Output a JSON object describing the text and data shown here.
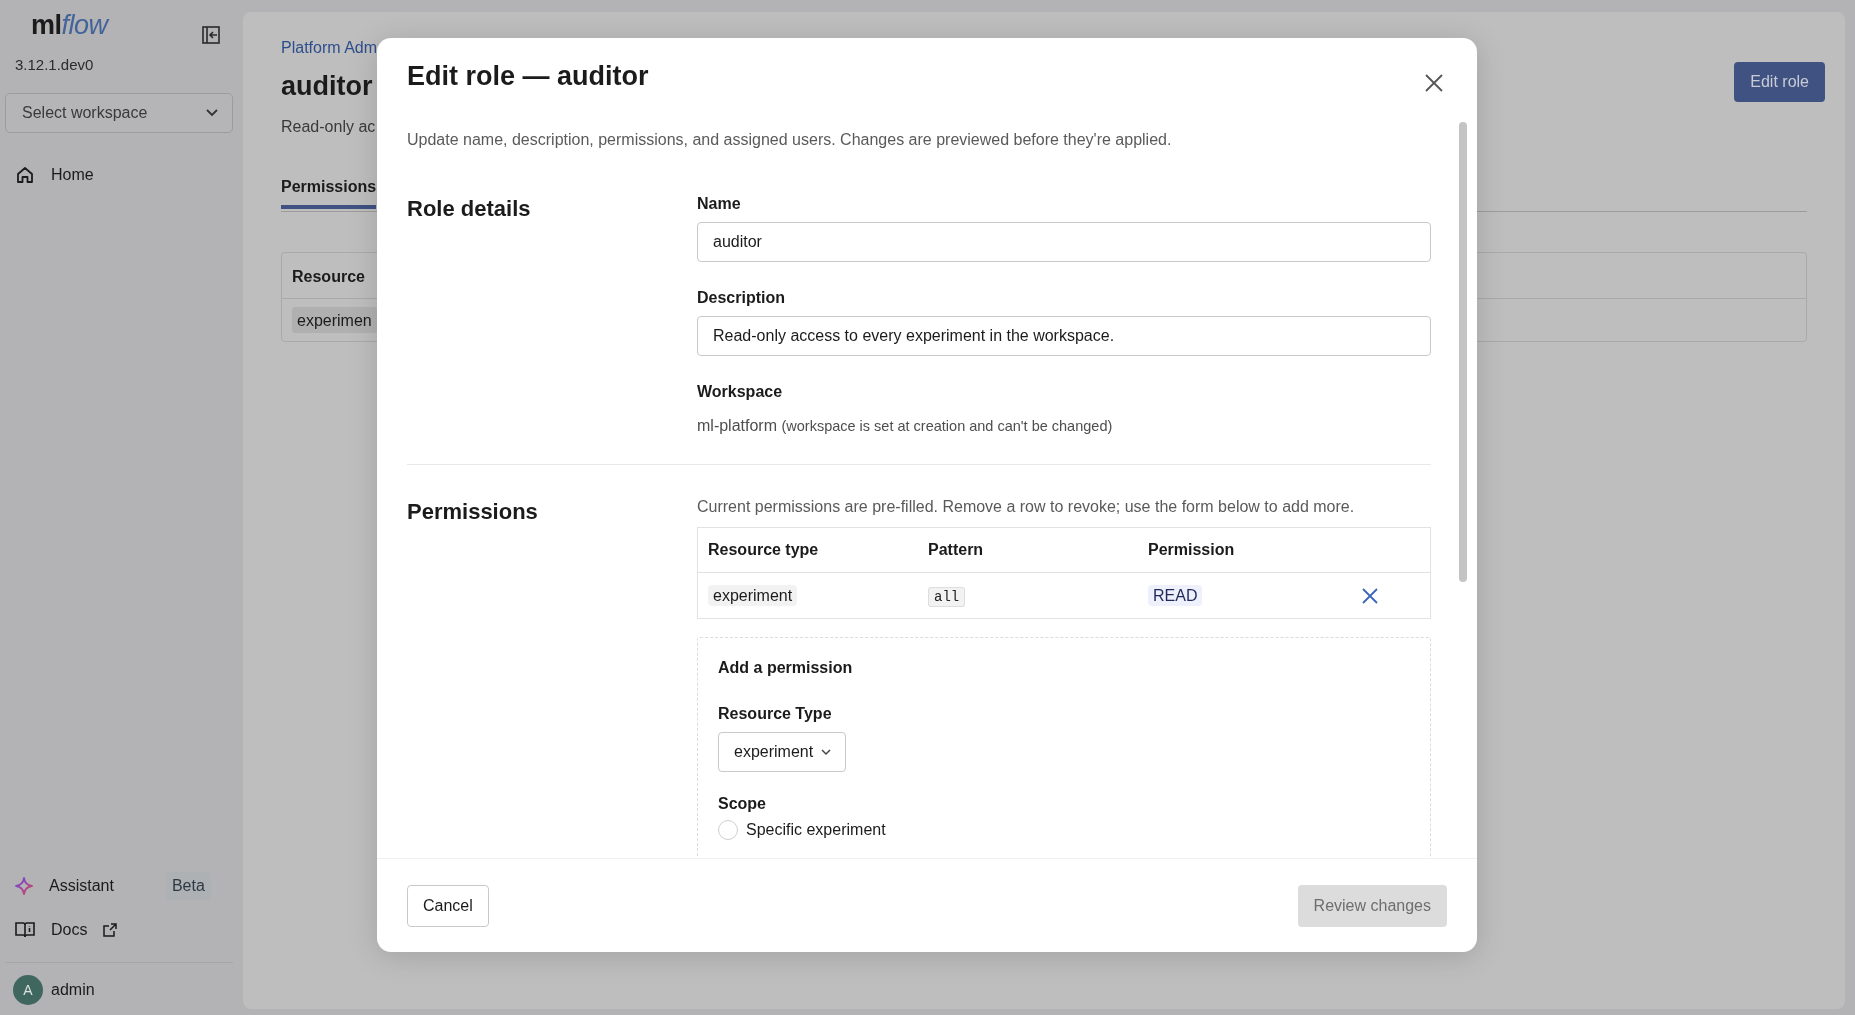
{
  "sidebar": {
    "logo": {
      "plain": "ml",
      "styled": "flow"
    },
    "version": "3.12.1.dev0",
    "workspace_select": {
      "placeholder": "Select workspace"
    },
    "nav_items": [
      {
        "label": "Home"
      }
    ],
    "bottom_items": [
      {
        "label": "Assistant",
        "badge": "Beta",
        "external": false
      },
      {
        "label": "Docs",
        "external": true
      }
    ],
    "user": {
      "initial": "A",
      "name": "admin"
    }
  },
  "page": {
    "breadcrumb": "Platform Adm",
    "title": "auditor",
    "subtitle": "Read-only ac",
    "edit_button": "Edit role",
    "tabs": [
      {
        "label": "Permissions",
        "selected": true
      }
    ],
    "table": {
      "columns": [
        "Resource"
      ],
      "rows": [
        [
          "experimen"
        ]
      ]
    }
  },
  "modal": {
    "title": "Edit role — auditor",
    "description": "Update name, description, permissions, and assigned users. Changes are previewed before they're applied.",
    "role_details": {
      "heading": "Role details",
      "fields": [
        {
          "label": "Name",
          "value": "auditor"
        },
        {
          "label": "Description",
          "value": "Read-only access to every experiment in the workspace."
        }
      ],
      "workspace": {
        "label": "Workspace",
        "value": "ml-platform",
        "note": "(workspace is set at creation and can't be changed)"
      }
    },
    "permissions": {
      "heading": "Permissions",
      "hint": "Current permissions are pre-filled. Remove a row to revoke; use the form below to add more.",
      "columns": [
        "Resource type",
        "Pattern",
        "Permission"
      ],
      "rows": [
        {
          "resource_type": "experiment",
          "pattern": "all",
          "permission": "READ"
        }
      ],
      "add": {
        "title": "Add a permission",
        "resource_type": {
          "label": "Resource Type",
          "value": "experiment"
        },
        "scope": {
          "label": "Scope",
          "options": [
            {
              "label": "Specific experiment",
              "selected": false
            }
          ]
        }
      }
    },
    "footer": {
      "cancel": "Cancel",
      "submit": {
        "label": "Review changes",
        "disabled": true
      }
    }
  }
}
